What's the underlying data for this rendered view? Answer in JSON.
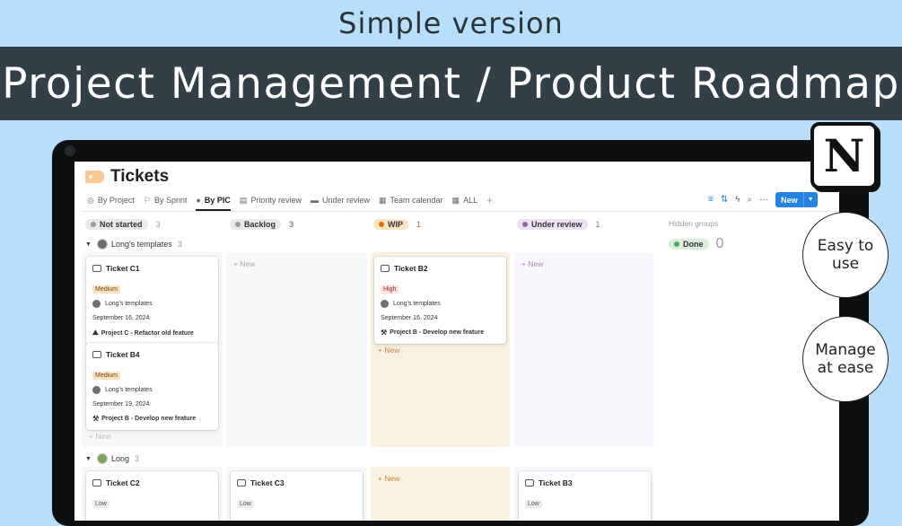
{
  "header": {
    "caption": "Simple version",
    "banner": "Project Management / Product Roadmap"
  },
  "page": {
    "title": "Tickets"
  },
  "views": [
    {
      "label": "By Project",
      "icon": "target-icon"
    },
    {
      "label": "By Sprint",
      "icon": "runner-icon"
    },
    {
      "label": "By PIC",
      "icon": "person-icon"
    },
    {
      "label": "Priority review",
      "icon": "table-icon"
    },
    {
      "label": "Under review",
      "icon": "board-icon"
    },
    {
      "label": "Team calendar",
      "icon": "calendar-icon"
    },
    {
      "label": "ALL",
      "icon": "table-icon"
    }
  ],
  "toolbar": {
    "new_label": "New"
  },
  "columns": [
    {
      "label": "Not started",
      "count": "3",
      "color": "#9b9b9b",
      "bg": "#e9e9e7"
    },
    {
      "label": "Backlog",
      "count": "3",
      "color": "#9b9b9b",
      "bg": "#e9e9e7"
    },
    {
      "label": "WIP",
      "count": "1",
      "color": "#d9730d",
      "bg": "#fae3c3"
    },
    {
      "label": "Under review",
      "count": "1",
      "color": "#9065b0",
      "bg": "#ebe1f3"
    }
  ],
  "hidden": {
    "label": "Hidden groups",
    "done_label": "Done",
    "done_count": "0",
    "done_color": "#4dab6f"
  },
  "groups": [
    {
      "name": "Long's templates",
      "count": "3"
    },
    {
      "name": "Long",
      "count": "3"
    }
  ],
  "cards": {
    "c1": {
      "title": "Ticket C1",
      "priority": "Medium",
      "pic": "Long's templates",
      "date": "September 16, 2024",
      "project": "Project C - Refactor old feature"
    },
    "b4": {
      "title": "Ticket B4",
      "priority": "Medium",
      "pic": "Long's templates",
      "date": "September 19, 2024",
      "project": "Project B - Develop new feature"
    },
    "b2": {
      "title": "Ticket B2",
      "priority": "High",
      "pic": "Long's templates",
      "date": "September 16, 2024",
      "project": "Project B - Develop new feature"
    },
    "c2": {
      "title": "Ticket C2",
      "priority": "Low"
    },
    "c3": {
      "title": "Ticket C3",
      "priority": "Low"
    },
    "b3": {
      "title": "Ticket B3",
      "priority": "Low"
    }
  },
  "new_item": "+ New",
  "bubbles": {
    "easy": "Easy to\nuse",
    "manage": "Manage\nat ease"
  },
  "logo_letter": "N"
}
